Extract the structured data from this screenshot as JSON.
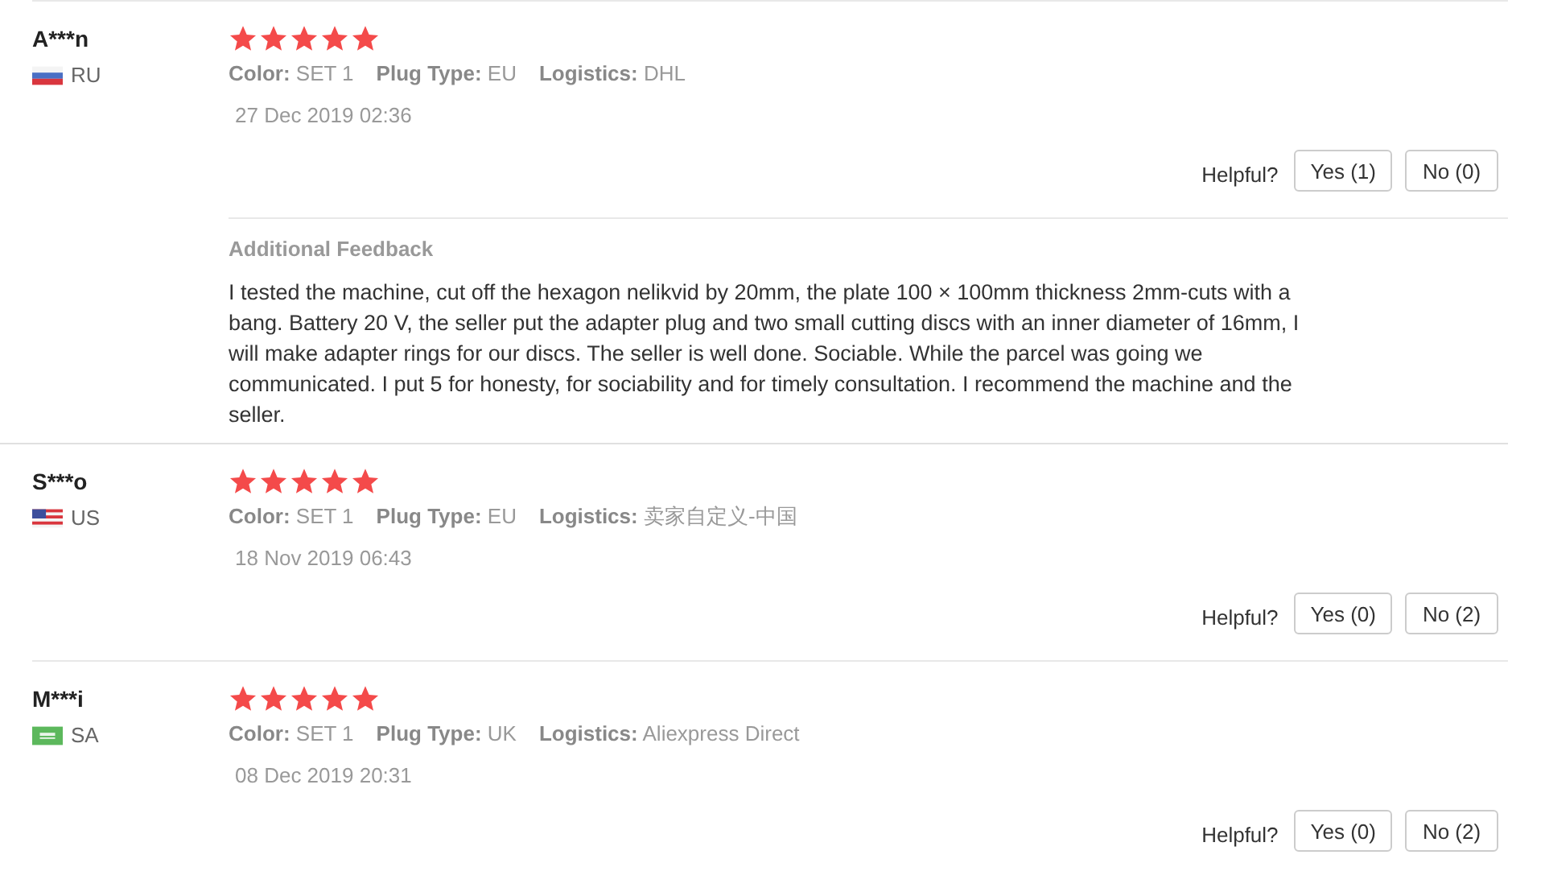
{
  "reviews": [
    {
      "name": "A***n",
      "kind": "ru",
      "country": "RU",
      "stars": 5,
      "attributes": [
        {
          "label": "Color:",
          "value": "SET 1"
        },
        {
          "label": "Plug Type:",
          "value": "EU"
        },
        {
          "label": "Logistics:",
          "value": "DHL"
        }
      ],
      "date": "27 Dec 2019 02:36",
      "helpful_label": "Helpful?",
      "yes": "Yes (1)",
      "no": "No (0)",
      "additional": {
        "title": "Additional Feedback",
        "text": "I tested the machine, cut off the hexagon nelikvid by 20mm, the plate 100 × 100mm thickness 2mm-cuts with a bang. Battery 20 V, the seller put the adapter plug and two small cutting discs with an inner diameter of 16mm, I will make adapter rings for our discs. The seller is well done. Sociable. While the parcel was going we communicated. I put 5 for honesty, for sociability and for timely consultation. I recommend the machine and the seller."
      }
    },
    {
      "name": "S***o",
      "kind": "us",
      "country": "US",
      "stars": 5,
      "attributes": [
        {
          "label": "Color:",
          "value": "SET 1"
        },
        {
          "label": "Plug Type:",
          "value": "EU"
        },
        {
          "label": "Logistics:",
          "value": "卖家自定义-中国"
        }
      ],
      "date": "18 Nov 2019 06:43",
      "helpful_label": "Helpful?",
      "yes": "Yes (0)",
      "no": "No (2)"
    },
    {
      "name": "M***i",
      "kind": "sa",
      "country": "SA",
      "stars": 5,
      "attributes": [
        {
          "label": "Color:",
          "value": "SET 1"
        },
        {
          "label": "Plug Type:",
          "value": "UK"
        },
        {
          "label": "Logistics:",
          "value": "Aliexpress Direct"
        }
      ],
      "date": "08 Dec 2019 20:31",
      "helpful_label": "Helpful?",
      "yes": "Yes (0)",
      "no": "No (2)"
    }
  ]
}
